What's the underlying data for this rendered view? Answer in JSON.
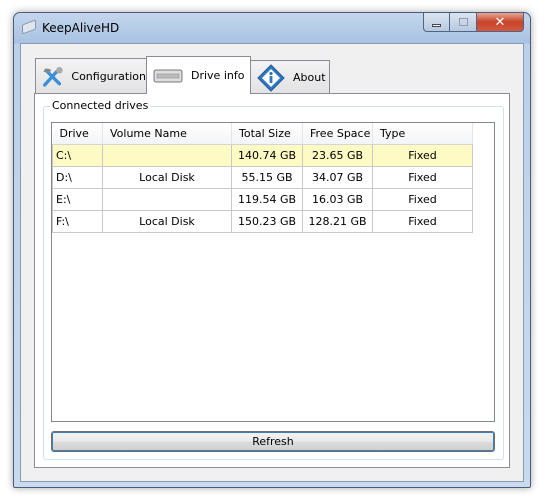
{
  "window": {
    "title": "KeepAliveHD",
    "minimize": "–",
    "maximize": "□",
    "close": "✕"
  },
  "tabs": [
    {
      "label": "Configuration",
      "icon": "tools-icon"
    },
    {
      "label": "Drive info",
      "icon": "drive-icon",
      "active": true
    },
    {
      "label": "About",
      "icon": "info-icon"
    }
  ],
  "group": {
    "label": "Connected drives"
  },
  "table": {
    "columns": [
      "Drive",
      "Volume Name",
      "Total Size",
      "Free Space",
      "Type"
    ],
    "rows": [
      {
        "drive": "C:\\",
        "volume": "",
        "total": "140.74 GB",
        "free": "23.65 GB",
        "type": "Fixed",
        "selected": true
      },
      {
        "drive": "D:\\",
        "volume": "Local Disk",
        "total": "55.15 GB",
        "free": "34.07 GB",
        "type": "Fixed"
      },
      {
        "drive": "E:\\",
        "volume": "",
        "total": "119.54 GB",
        "free": "16.03 GB",
        "type": "Fixed"
      },
      {
        "drive": "F:\\",
        "volume": "Local Disk",
        "total": "150.23 GB",
        "free": "128.21 GB",
        "type": "Fixed"
      }
    ]
  },
  "refresh_label": "Refresh",
  "colors": {
    "selected_row": "#fdfbc3",
    "title_bar": "#a9c2e2"
  }
}
